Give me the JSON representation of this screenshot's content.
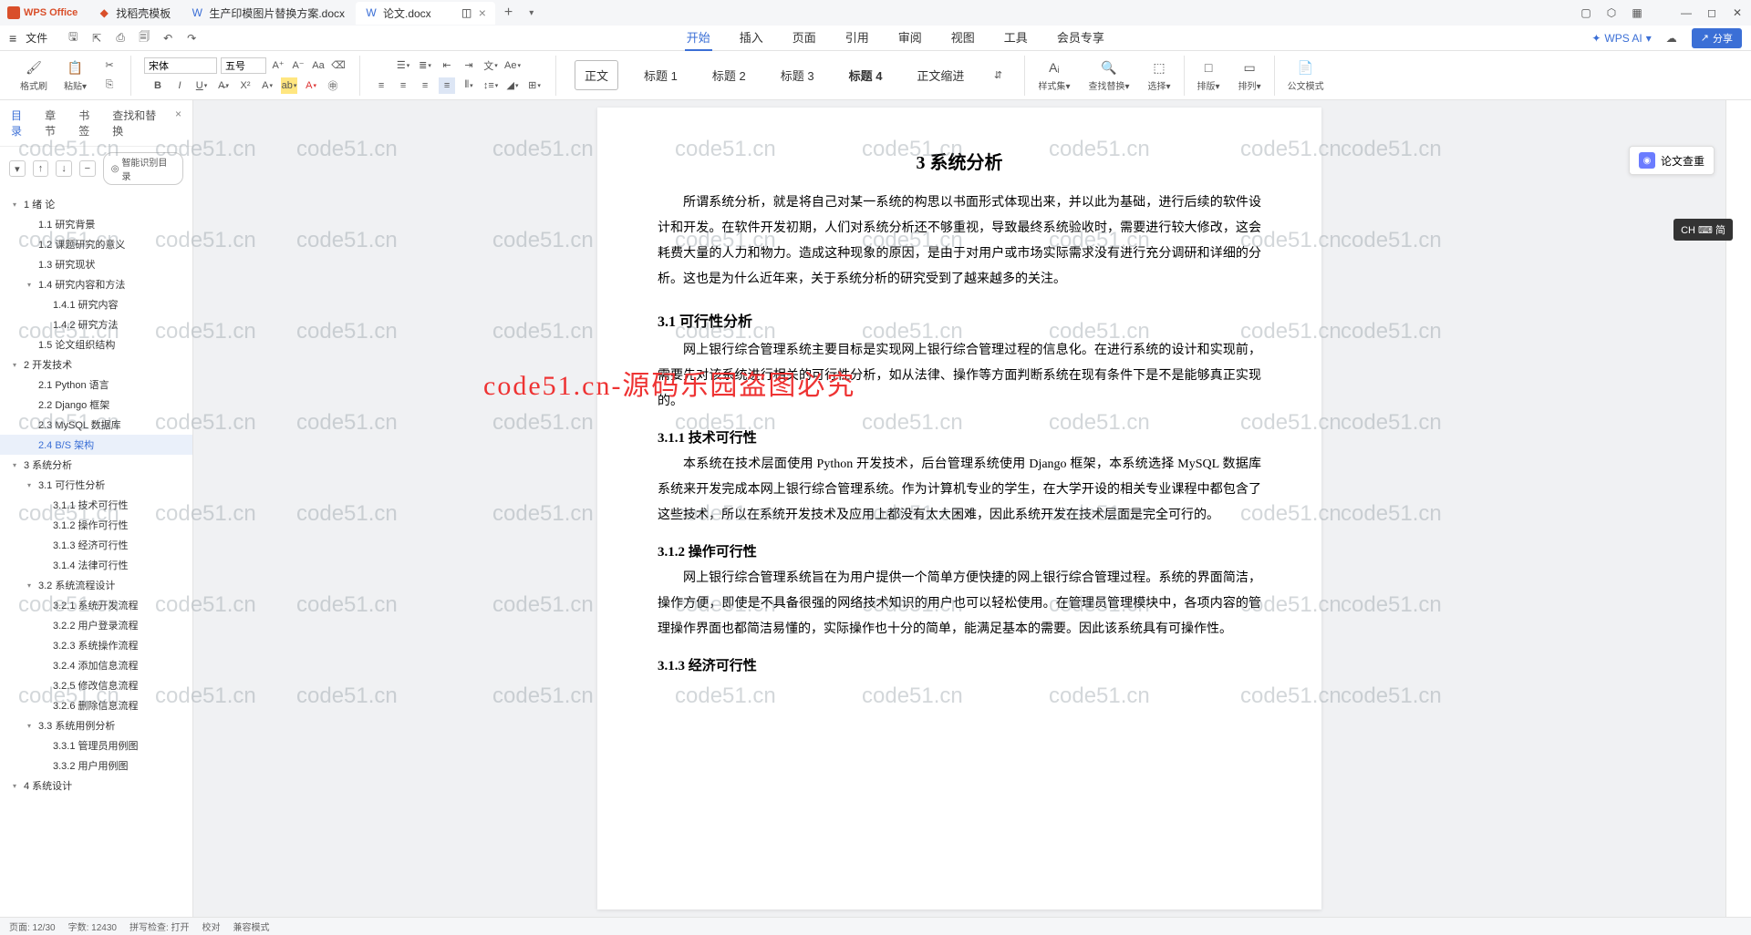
{
  "app_name": "WPS Office",
  "tabs": [
    {
      "label": "找稻壳模板",
      "type": "template"
    },
    {
      "label": "生产印模图片替换方案.docx",
      "type": "doc"
    },
    {
      "label": "论文.docx",
      "type": "doc",
      "active": true
    }
  ],
  "menubar": {
    "file": "文件",
    "items": [
      "开始",
      "插入",
      "页面",
      "引用",
      "审阅",
      "视图",
      "工具",
      "会员专享"
    ],
    "active": "开始",
    "ai": "WPS AI",
    "share": "分享"
  },
  "ribbon": {
    "format_painter": "格式刷",
    "paste": "粘贴",
    "font_name": "宋体",
    "font_size": "五号",
    "styles": {
      "body": "正文",
      "h1": "标题 1",
      "h2": "标题 2",
      "h3": "标题 3",
      "h4": "标题 4",
      "body_indent": "正文缩进"
    },
    "style_set": "样式集",
    "find_replace": "查找替换",
    "select": "选择",
    "layout": "排版",
    "arrange": "排列",
    "official_mode": "公文模式"
  },
  "sidebar": {
    "tabs": [
      "目录",
      "章节",
      "书签",
      "查找和替换"
    ],
    "active_tab": "目录",
    "smart_toc": "智能识别目录",
    "toc": [
      {
        "level": 1,
        "text": "1 绪    论",
        "caret": true
      },
      {
        "level": 2,
        "text": "1.1 研究背景"
      },
      {
        "level": 2,
        "text": "1.2 课题研究的意义"
      },
      {
        "level": 2,
        "text": "1.3 研究现状"
      },
      {
        "level": 2,
        "text": "1.4 研究内容和方法",
        "caret": true
      },
      {
        "level": 3,
        "text": "1.4.1 研究内容"
      },
      {
        "level": 3,
        "text": "1.4.2 研究方法"
      },
      {
        "level": 2,
        "text": "1.5 论文组织结构"
      },
      {
        "level": 1,
        "text": "2 开发技术",
        "caret": true
      },
      {
        "level": 2,
        "text": "2.1 Python 语言"
      },
      {
        "level": 2,
        "text": "2.2 Django 框架"
      },
      {
        "level": 2,
        "text": "2.3 MySQL 数据库"
      },
      {
        "level": 2,
        "text": "2.4 B/S 架构",
        "active": true
      },
      {
        "level": 1,
        "text": "3 系统分析",
        "caret": true
      },
      {
        "level": 2,
        "text": "3.1  可行性分析",
        "caret": true
      },
      {
        "level": 3,
        "text": "3.1.1  技术可行性"
      },
      {
        "level": 3,
        "text": "3.1.2  操作可行性"
      },
      {
        "level": 3,
        "text": "3.1.3  经济可行性"
      },
      {
        "level": 3,
        "text": "3.1.4  法律可行性"
      },
      {
        "level": 2,
        "text": "3.2  系统流程设计",
        "caret": true
      },
      {
        "level": 3,
        "text": "3.2.1  系统开发流程"
      },
      {
        "level": 3,
        "text": "3.2.2  用户登录流程"
      },
      {
        "level": 3,
        "text": "3.2.3  系统操作流程"
      },
      {
        "level": 3,
        "text": "3.2.4  添加信息流程"
      },
      {
        "level": 3,
        "text": "3.2.5  修改信息流程"
      },
      {
        "level": 3,
        "text": "3.2.6  删除信息流程"
      },
      {
        "level": 2,
        "text": "3.3  系统用例分析",
        "caret": true
      },
      {
        "level": 3,
        "text": "3.3.1  管理员用例图"
      },
      {
        "level": 3,
        "text": "3.3.2  用户用例图"
      },
      {
        "level": 1,
        "text": "4 系统设计",
        "caret": true
      }
    ]
  },
  "document": {
    "h2": "3 系统分析",
    "p1": "所谓系统分析，就是将自己对某一系统的构思以书面形式体现出来，并以此为基础，进行后续的软件设计和开发。在软件开发初期，人们对系统分析还不够重视，导致最终系统验收时，需要进行较大修改，这会耗费大量的人力和物力。造成这种现象的原因，是由于对用户或市场实际需求没有进行充分调研和详细的分析。这也是为什么近年来，关于系统分析的研究受到了越来越多的关注。",
    "h3_1": "3.1  可行性分析",
    "p2": "网上银行综合管理系统主要目标是实现网上银行综合管理过程的信息化。在进行系统的设计和实现前，需要先对该系统进行相关的可行性分析，如从法律、操作等方面判断系统在现有条件下是不是能够真正实现的。",
    "h4_1": "3.1.1  技术可行性",
    "p3": "本系统在技术层面使用 Python 开发技术，后台管理系统使用 Django 框架，本系统选择 MySQL 数据库系统来开发完成本网上银行综合管理系统。作为计算机专业的学生，在大学开设的相关专业课程中都包含了这些技术，所以在系统开发技术及应用上都没有太大困难，因此系统开发在技术层面是完全可行的。",
    "h4_2": "3.1.2  操作可行性",
    "p4": "网上银行综合管理系统旨在为用户提供一个简单方便快捷的网上银行综合管理过程。系统的界面简洁，操作方便，即使是不具备很强的网络技术知识的用户也可以轻松使用。在管理员管理模块中，各项内容的管理操作界面也都简洁易懂的，实际操作也十分的简单，能满足基本的需要。因此该系统具有可操作性。",
    "h4_3": "3.1.3  经济可行性"
  },
  "overlay": "code51.cn-源码乐园盗图必究",
  "watermark": "code51.cn",
  "float_panel": "论文查重",
  "ime": "CH ⌨ 简",
  "statusbar": {
    "page": "页面: 12/30",
    "words": "字数: 12430",
    "spell": "拼写检查: 打开",
    "proof": "校对",
    "mode": "兼容模式"
  }
}
